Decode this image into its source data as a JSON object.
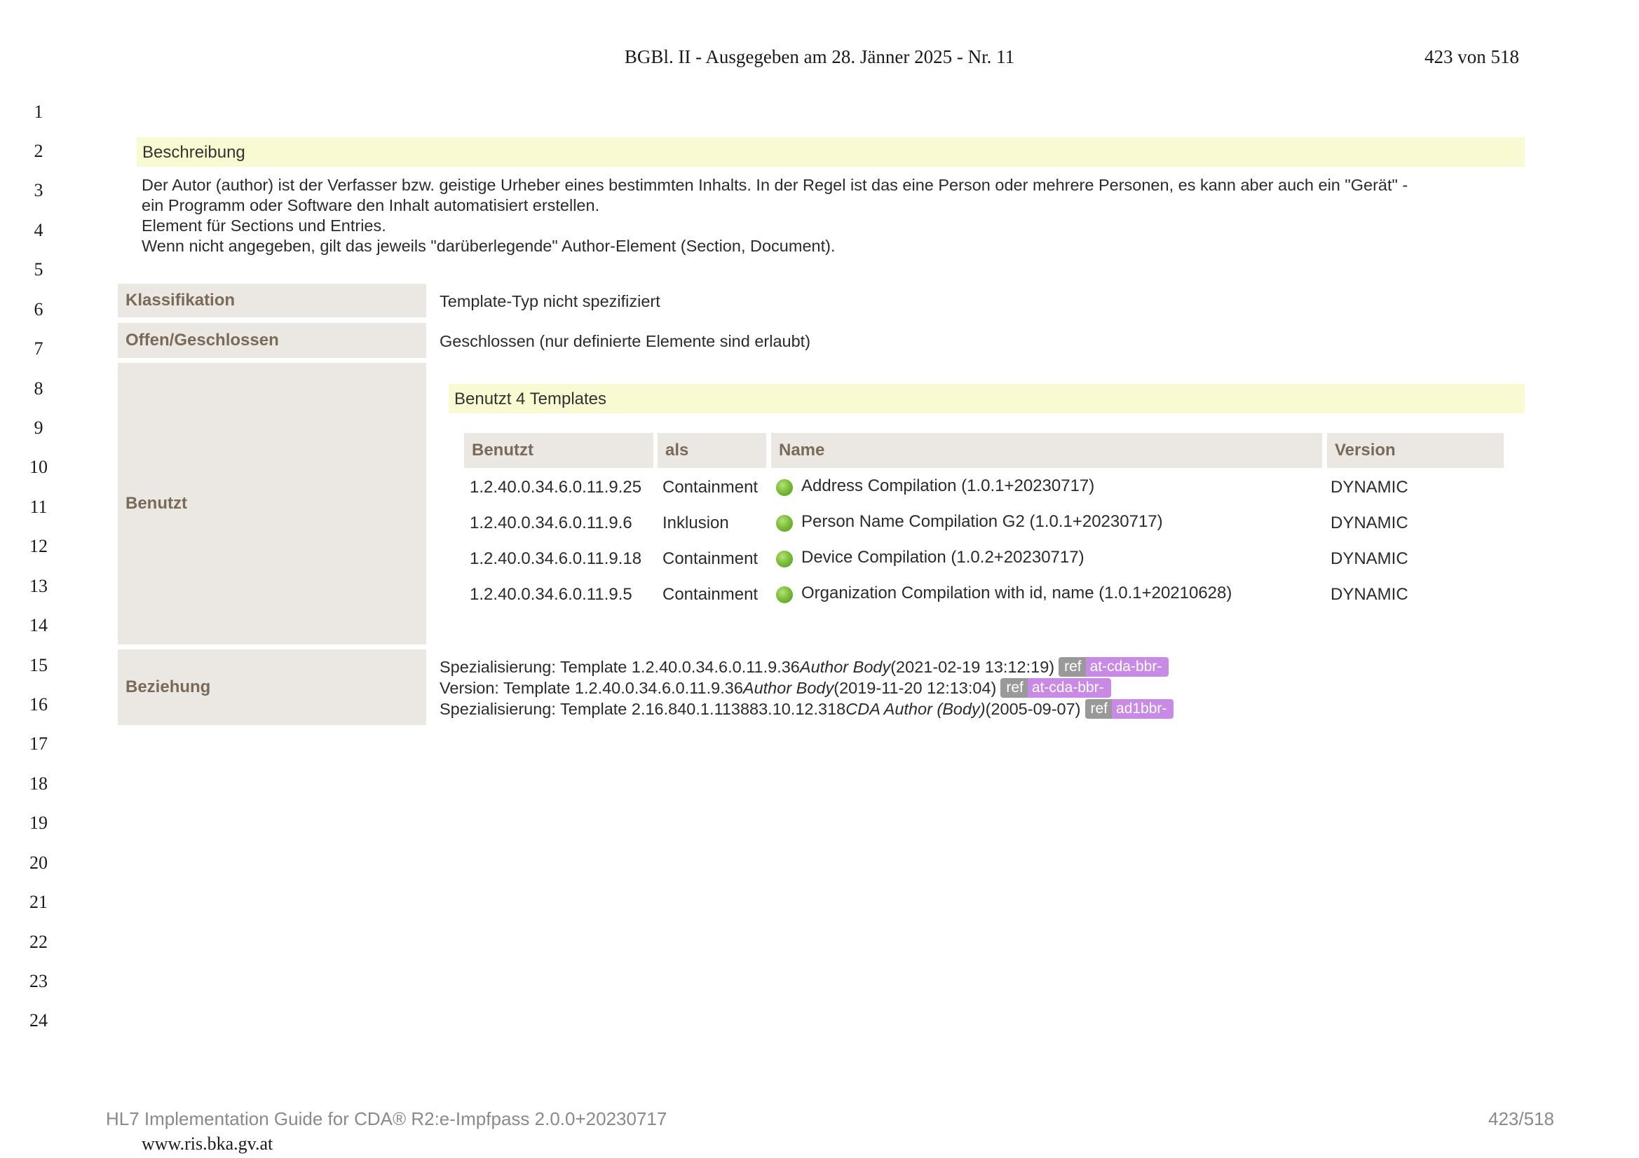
{
  "header": {
    "title": "BGBl. II - Ausgegeben am 28. Jänner 2025 - Nr. 11",
    "page": "423 von 518"
  },
  "line_numbers": [
    "1",
    "2",
    "3",
    "4",
    "5",
    "6",
    "7",
    "8",
    "9",
    "10",
    "11",
    "12",
    "13",
    "14",
    "15",
    "16",
    "17",
    "18",
    "19",
    "20",
    "21",
    "22",
    "23",
    "24"
  ],
  "description": {
    "heading": "Beschreibung",
    "lines": [
      "Der Autor (author) ist der Verfasser bzw. geistige Urheber eines bestimmten Inhalts. In der Regel ist das eine Person oder mehrere Personen, es kann aber auch ein \"Gerät\" -",
      "ein Programm oder Software den Inhalt automatisiert erstellen.",
      "Element für Sections und Entries.",
      "Wenn nicht angegeben, gilt das jeweils \"darüberlegende\" Author-Element (Section, Document)."
    ]
  },
  "properties": {
    "classification": {
      "label": "Klassifikation",
      "value": "Template-Typ nicht spezifiziert"
    },
    "open_closed": {
      "label": "Offen/Geschlossen",
      "value": "Geschlossen (nur definierte Elemente sind erlaubt)"
    },
    "uses": {
      "label": "Benutzt"
    },
    "relationship": {
      "label": "Beziehung"
    }
  },
  "templates": {
    "heading": "Benutzt 4 Templates",
    "columns": [
      "Benutzt",
      "als",
      "Name",
      "Version"
    ],
    "rows": [
      {
        "id": "1.2.40.0.34.6.0.11.9.25",
        "as": "Containment",
        "name": "Address Compilation (1.0.1+20230717)",
        "version": "DYNAMIC"
      },
      {
        "id": "1.2.40.0.34.6.0.11.9.6",
        "as": "Inklusion",
        "name": "Person Name Compilation G2 (1.0.1+20230717)",
        "version": "DYNAMIC"
      },
      {
        "id": "1.2.40.0.34.6.0.11.9.18",
        "as": "Containment",
        "name": "Device Compilation (1.0.2+20230717)",
        "version": "DYNAMIC"
      },
      {
        "id": "1.2.40.0.34.6.0.11.9.5",
        "as": "Containment",
        "name": "Organization Compilation with id, name (1.0.1+20210628)",
        "version": "DYNAMIC"
      }
    ]
  },
  "relationships": [
    {
      "prefix": "Spezialisierung: Template 1.2.40.0.34.6.0.11.9.36 ",
      "name": "Author Body",
      "date": " (2021‑02‑19 13:12:19)",
      "ref": "ref",
      "code": "at-cda-bbr-"
    },
    {
      "prefix": "Version: Template 1.2.40.0.34.6.0.11.9.36 ",
      "name": "Author Body",
      "date": " (2019‑11‑20 12:13:04)",
      "ref": "ref",
      "code": "at-cda-bbr-"
    },
    {
      "prefix": "Spezialisierung: Template 2.16.840.1.113883.10.12.318 ",
      "name": "CDA Author (Body)",
      "date": " (2005‑09‑07)",
      "ref": "ref",
      "code": "ad1bbr-"
    }
  ],
  "footer": {
    "left": "HL7 Implementation Guide for CDA® R2:e-Impfpass 2.0.0+20230717",
    "right": "423/518",
    "url": "www.ris.bka.gv.at"
  }
}
